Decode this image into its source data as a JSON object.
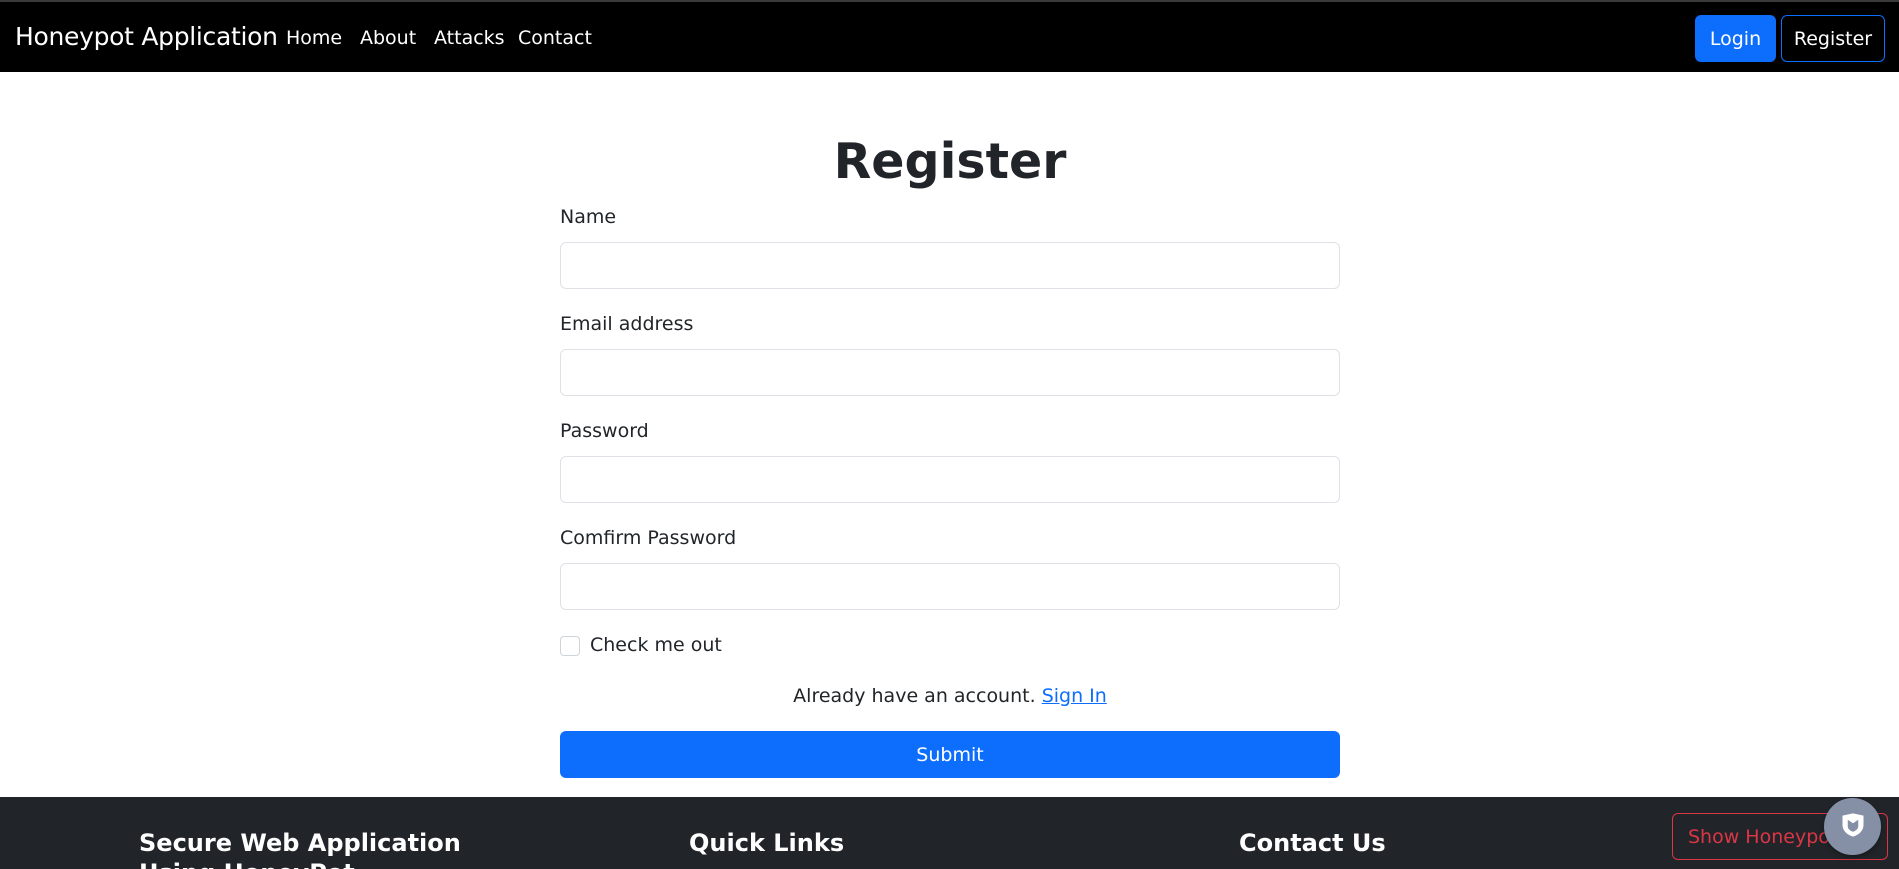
{
  "navbar": {
    "brand": "Honeypot Application",
    "links": [
      "Home",
      "About",
      "Attacks",
      "Contact"
    ],
    "login_label": "Login",
    "register_label": "Register"
  },
  "form": {
    "title": "Register",
    "fields": [
      {
        "label": "Name",
        "value": ""
      },
      {
        "label": "Email address",
        "value": ""
      },
      {
        "label": "Password",
        "value": ""
      },
      {
        "label": "Comfirm Password",
        "value": ""
      }
    ],
    "checkbox_label": "Check me out",
    "checkbox_checked": false,
    "signin_prompt": "Already have an account.",
    "signin_link": "Sign In",
    "submit_label": "Submit"
  },
  "footer": {
    "col1_title": "Secure Web Application",
    "col1_subtitle": "Using HoneyPot",
    "col2_title": "Quick Links",
    "col3_title": "Contact Us",
    "show_honeypot_label": "Show Honeypot"
  },
  "widget": {
    "icon": "shield-icon"
  },
  "colors": {
    "primary": "#0d6efd",
    "navbar_bg": "#000000",
    "footer_bg": "#212529",
    "danger": "#dc3545"
  }
}
